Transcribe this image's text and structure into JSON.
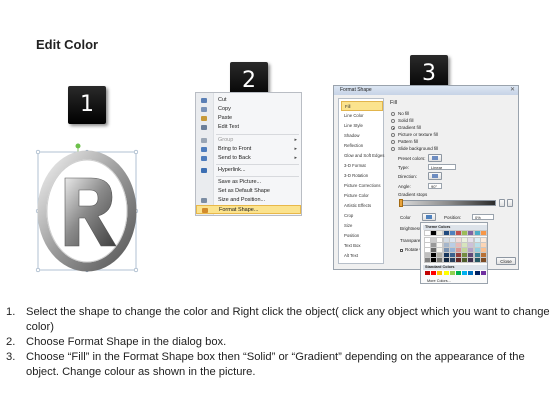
{
  "title": "Edit Color",
  "steps": {
    "one": "1",
    "two": "2",
    "three": "3"
  },
  "context_menu": {
    "items": [
      {
        "label": "Cut",
        "icon": "scissors-icon",
        "color": "#5a7fb5"
      },
      {
        "label": "Copy",
        "icon": "copy-icon",
        "color": "#7a93b8"
      },
      {
        "label": "Paste",
        "icon": "clipboard-icon",
        "color": "#c79a3a"
      },
      {
        "label": "Edit Text",
        "icon": "text-icon",
        "color": "#6b7f9a"
      },
      {
        "label": "Group",
        "icon": "group-icon",
        "color": "#9aa6b5"
      },
      {
        "label": "Bring to Front",
        "icon": "bring-front-icon",
        "color": "#4f7dbd"
      },
      {
        "label": "Send to Back",
        "icon": "send-back-icon",
        "color": "#4f7dbd"
      },
      {
        "label": "Hyperlink...",
        "icon": "hyperlink-icon",
        "color": "#3c6fb3"
      },
      {
        "label": "Save as Picture...",
        "icon": "",
        "color": ""
      },
      {
        "label": "Set as Default Shape",
        "icon": "",
        "color": ""
      },
      {
        "label": "Size and Position...",
        "icon": "size-icon",
        "color": "#7c8da3"
      },
      {
        "label": "Format Shape...",
        "icon": "format-shape-icon",
        "color": "#d28b2c"
      }
    ]
  },
  "dialog": {
    "title": "Format Shape",
    "nav": [
      "Fill",
      "Line Color",
      "Line Style",
      "Shadow",
      "Reflection",
      "Glow and Soft Edges",
      "3-D Format",
      "3-D Rotation",
      "Picture Corrections",
      "Picture Color",
      "Artistic Effects",
      "Crop",
      "Size",
      "Position",
      "Text Box",
      "Alt Text"
    ],
    "section": "Fill",
    "options": [
      "No fill",
      "Solid fill",
      "Gradient fill",
      "Picture or texture fill",
      "Pattern fill",
      "Slide background fill"
    ],
    "preset_label": "Preset colors:",
    "type_label": "Type:",
    "type_value": "Linear",
    "direction_label": "Direction:",
    "angle_label": "Angle:",
    "angle_value": "90°",
    "stops_label": "Gradient stops",
    "color_label": "Color",
    "position_label": "Position:",
    "position_value": "0%",
    "brightness_label": "Brightness:",
    "transparency_label": "Transparency:",
    "rotate_label": "Rotate with shape",
    "close_label": "Close"
  },
  "palette": {
    "theme_label": "Theme Colors",
    "standard_label": "Standard Colors",
    "more_label": "More Colors...",
    "theme_top": [
      "#ffffff",
      "#000000",
      "#eeece1",
      "#1f497d",
      "#4f81bd",
      "#c0504d",
      "#9bbb59",
      "#8064a2",
      "#4bacc6",
      "#f79646"
    ],
    "standard": [
      "#c00000",
      "#ff0000",
      "#ffc000",
      "#ffff00",
      "#92d050",
      "#00b050",
      "#00b0f0",
      "#0070c0",
      "#002060",
      "#7030a0"
    ]
  },
  "instructions": [
    {
      "num": "1.",
      "text": "Select the shape to change the color and Right click the object( click any object which you want to change color)"
    },
    {
      "num": "2.",
      "text": "Choose Format Shape in the dialog box."
    },
    {
      "num": "3.",
      "text": "Choose “Fill” in the Format Shape box then “Solid” or “Gradient” depending on the appearance of the object. Change colour as shown in the picture."
    }
  ]
}
